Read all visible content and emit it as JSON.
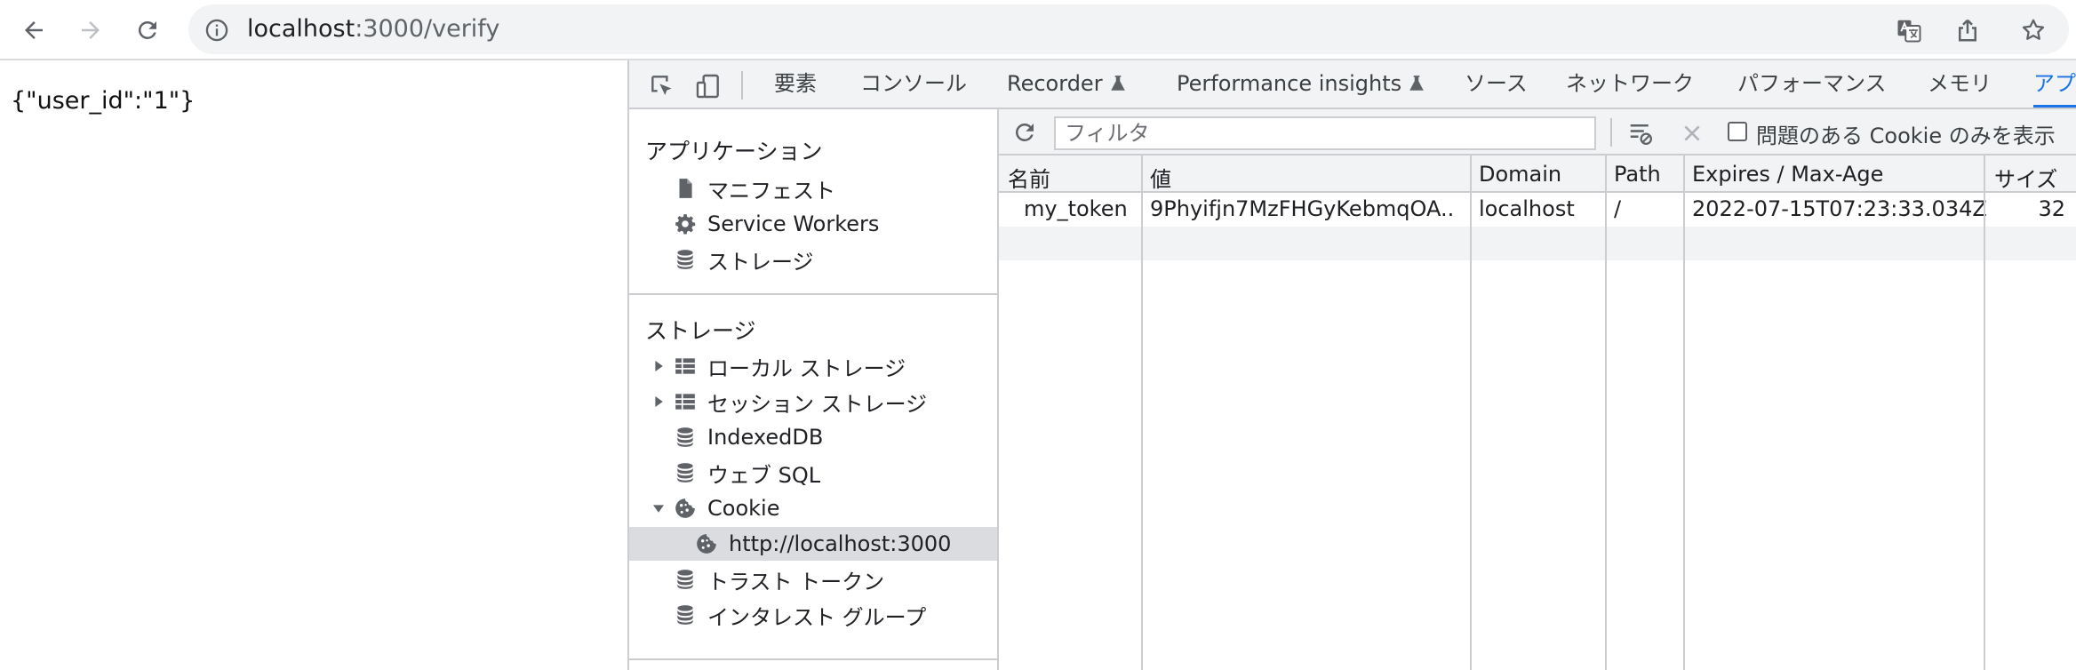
{
  "browser": {
    "url_host": "localhost",
    "url_path": ":3000/verify"
  },
  "page": {
    "json_text": "{\"user_id\":\"1\"}"
  },
  "devtools": {
    "tabs": [
      "要素",
      "コンソール",
      "Recorder",
      "Performance insights",
      "ソース",
      "ネットワーク",
      "パフォーマンス",
      "メモリ",
      "アプ"
    ],
    "sidebar": {
      "application_heading": "アプリケーション",
      "application_items": [
        "マニフェスト",
        "Service Workers",
        "ストレージ"
      ],
      "storage_heading": "ストレージ",
      "storage_items": [
        "ローカル ストレージ",
        "セッション ストレージ",
        "IndexedDB",
        "ウェブ SQL",
        "Cookie",
        "http://localhost:3000",
        "トラスト トークン",
        "インタレスト グループ"
      ]
    },
    "toolbar": {
      "filter_placeholder": "フィルタ",
      "only_issues_label": "問題のある Cookie のみを表示"
    },
    "table": {
      "headers": [
        "名前",
        "値",
        "Domain",
        "Path",
        "Expires / Max-Age",
        "サイズ"
      ],
      "rows": [
        [
          "my_token",
          "9Phyifjn7MzFHGyKebmqOA..",
          "localhost",
          "/",
          "2022-07-15T07:23:33.034Z",
          "32"
        ]
      ]
    }
  }
}
